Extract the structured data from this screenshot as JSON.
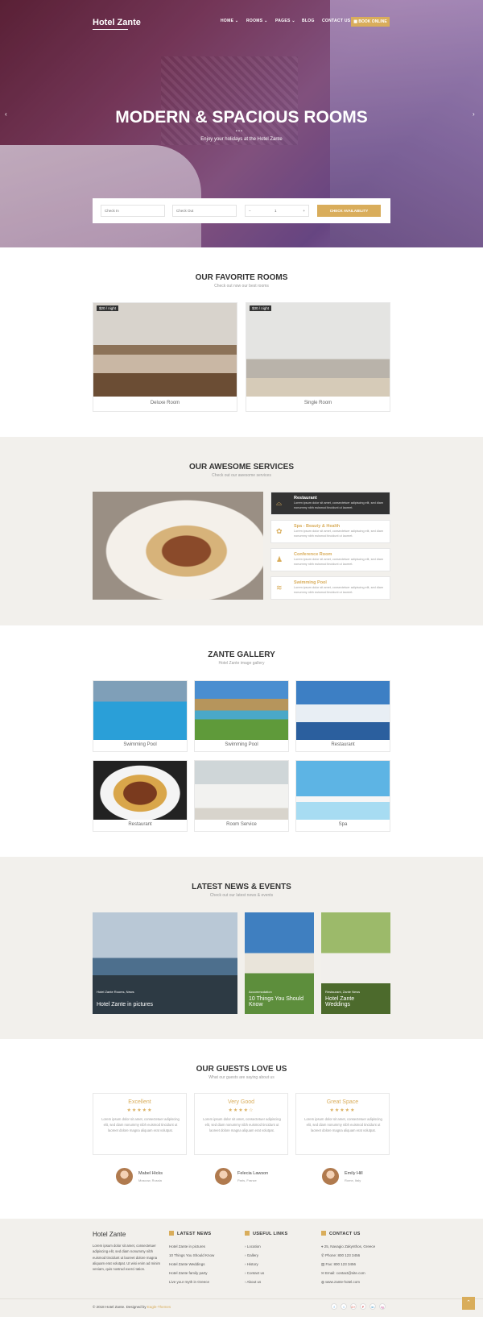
{
  "header": {
    "logo": "Hotel Zante",
    "nav": [
      "HOME",
      "ROOMS",
      "PAGES",
      "BLOG",
      "CONTACT US"
    ],
    "book_label": "BOOK ONLINE"
  },
  "hero": {
    "title": "MODERN & SPACIOUS ROOMS",
    "subtitle": "Enjoy your holidays at the Hotel Zante",
    "checkin_placeholder": "Check In",
    "checkout_placeholder": "Check Out",
    "guests_value": "1",
    "minus": "−",
    "plus": "+",
    "check_label": "CHECK AVAILABILITY"
  },
  "rooms": {
    "title": "OUR FAVORITE ROOMS",
    "subtitle": "Check out now our best rooms",
    "items": [
      {
        "price": "$20 / night",
        "name": "Deluxe Room"
      },
      {
        "price": "$30 / night",
        "name": "Single Room"
      }
    ]
  },
  "services": {
    "title": "OUR AWESOME SERVICES",
    "subtitle": "Check out our awesome services",
    "items": [
      {
        "name": "Restaurant",
        "icon": "restaurant-icon",
        "desc": "Lorem ipsum dolor sit amet, consectetuer adipiscing elit, sed diam nonummy nibh euismod tincidunt ut laoreet."
      },
      {
        "name": "Spa - Beauty & Health",
        "icon": "spa-icon",
        "desc": "Lorem ipsum dolor sit amet, consectetuer adipiscing elit, sed diam nonummy nibh euismod tincidunt ut laoreet."
      },
      {
        "name": "Conference Room",
        "icon": "conference-icon",
        "desc": "Lorem ipsum dolor sit amet, consectetuer adipiscing elit, sed diam nonummy nibh euismod tincidunt ut laoreet."
      },
      {
        "name": "Swimming Pool",
        "icon": "pool-icon",
        "desc": "Lorem ipsum dolor sit amet, consectetuer adipiscing elit, sed diam nonummy nibh euismod tincidunt ut laoreet."
      }
    ]
  },
  "gallery": {
    "title": "ZANTE GALLERY",
    "subtitle": "Hotel Zante image gallery",
    "items": [
      "Swimming Pool",
      "Swimming Pool",
      "Restaurant",
      "Restaurant",
      "Room Service",
      "Spa"
    ]
  },
  "news": {
    "title": "LATEST NEWS & EVENTS",
    "subtitle": "Check out our latest news & events",
    "items": [
      {
        "category": "Hotel Zante Rooms, News",
        "title": "Hotel Zante in pictures"
      },
      {
        "category": "Accommodation",
        "title": "10 Things You Should Know"
      },
      {
        "category": "Restaurant, Zante News",
        "title": "Hotel Zante Weddings"
      }
    ]
  },
  "guests": {
    "title": "OUR GUESTS LOVE US",
    "subtitle": "What our guests are saying about us",
    "items": [
      {
        "heading": "Excellent",
        "stars": "★★★★★",
        "text": "Lorem ipsum dolor sit amet, consectetuer adipiscing elit, sed diam nonummy nibh euismod tincidunt ut laoreet dolore magna aliquam erat volutpat.",
        "name": "Mabel Hicks",
        "location": "Moscow, Russia"
      },
      {
        "heading": "Very Good",
        "stars": "★★★★☆",
        "text": "Lorem ipsum dolor sit amet, consectetuer adipiscing elit, sed diam nonummy nibh euismod tincidunt ut laoreet dolore magna aliquam erat volutpat.",
        "name": "Felecia Lawson",
        "location": "Paris, France"
      },
      {
        "heading": "Great Space",
        "stars": "★★★★★",
        "text": "Lorem ipsum dolor sit amet, consectetuer adipiscing elit, sed diam nonummy nibh euismod tincidunt ut laoreet dolore magna aliquam erat volutpat.",
        "name": "Emily Hill",
        "location": "Rome, Italy"
      }
    ]
  },
  "footer": {
    "logo": "Hotel Zante",
    "about": "Lorem ipsum dolor sit amet, consectetuer adipiscing elit, sed diam nonummy nibh euismod tincidunt ut laoreet dolore magna aliquam erat volutpat. Ut wisi enim ad minim veniam, quis nostrud exerci tation.",
    "news_title": "LATEST NEWS",
    "news_links": [
      "Hotel Zante in pictures",
      "10 Things You Should Know",
      "Hotel Zante Weddings",
      "Hotel Zante family party",
      "Live your myth in Greece"
    ],
    "links_title": "USEFUL LINKS",
    "links": [
      "Location",
      "Gallery",
      "History",
      "Contact us",
      "About us"
    ],
    "contact_title": "CONTACT US",
    "contact": [
      "25, Navagio Zakynthos, Greece",
      "Phone: 800 123 3456",
      "Fax: 800 123 3456",
      "Email: contact@site.com",
      "www.zante-hotel.com"
    ],
    "copyright": "© 2018 Hotel Zante. Designed by",
    "designer": "Eagle-Themes",
    "social": [
      "f",
      "t",
      "G+",
      "P",
      "in",
      "ig"
    ]
  },
  "colors": {
    "accent": "#d9ad5b",
    "dark": "#333333",
    "section_gray": "#f2f0ec"
  }
}
